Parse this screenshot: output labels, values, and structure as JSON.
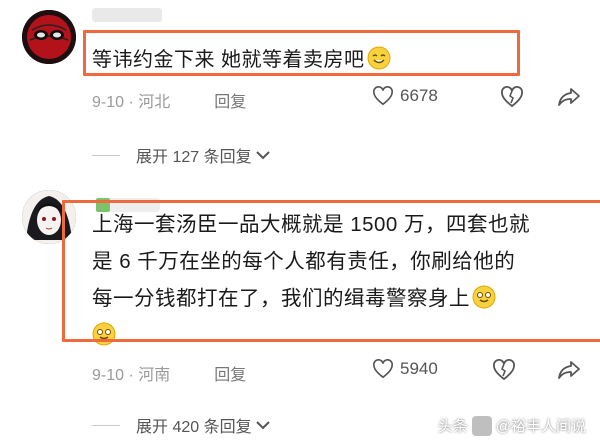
{
  "comments": [
    {
      "text": "等讳约金下来 她就等着卖房吧",
      "date_location": "9-10 · 河北",
      "reply_label": "回复",
      "likes": "6678",
      "expand_label": "展开 127 条回复"
    },
    {
      "lines": [
        "上海一套汤臣一品大概就是 1500 万，四套也就",
        "是 6 千万在坐的每个人都有责任，你刷给他的",
        "每一分钱都打在了，我们的缉毒警察身上"
      ],
      "date_location": "9-10 · 河南",
      "reply_label": "回复",
      "likes": "5940",
      "expand_label": "展开 420 条回复"
    }
  ],
  "watermark": {
    "left": "头条",
    "right": "@裕丰人间说"
  },
  "colors": {
    "highlight": "#ee6a3c",
    "meta": "#9a9a9a"
  }
}
